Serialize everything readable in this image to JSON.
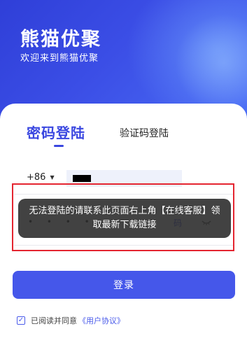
{
  "header": {
    "brand": "熊猫优聚",
    "welcome": "欢迎来到熊猫优聚"
  },
  "tabs": {
    "password_login": "密码登陆",
    "code_login": "验证码登陆"
  },
  "form": {
    "country_code": "+86",
    "password_masked": "• • • •",
    "password_suffix": "码"
  },
  "toast": {
    "message": "无法登陆的请联系此页面右上角【在线客服】领取最新下载链接"
  },
  "actions": {
    "login_label": "登录"
  },
  "agreement": {
    "prefix": "已阅读并同意",
    "link": "《用户协议》",
    "checked": true
  },
  "colors": {
    "accent": "#4557ea",
    "hero_start": "#2f3fd8",
    "toast_highlight": "#e42530"
  }
}
